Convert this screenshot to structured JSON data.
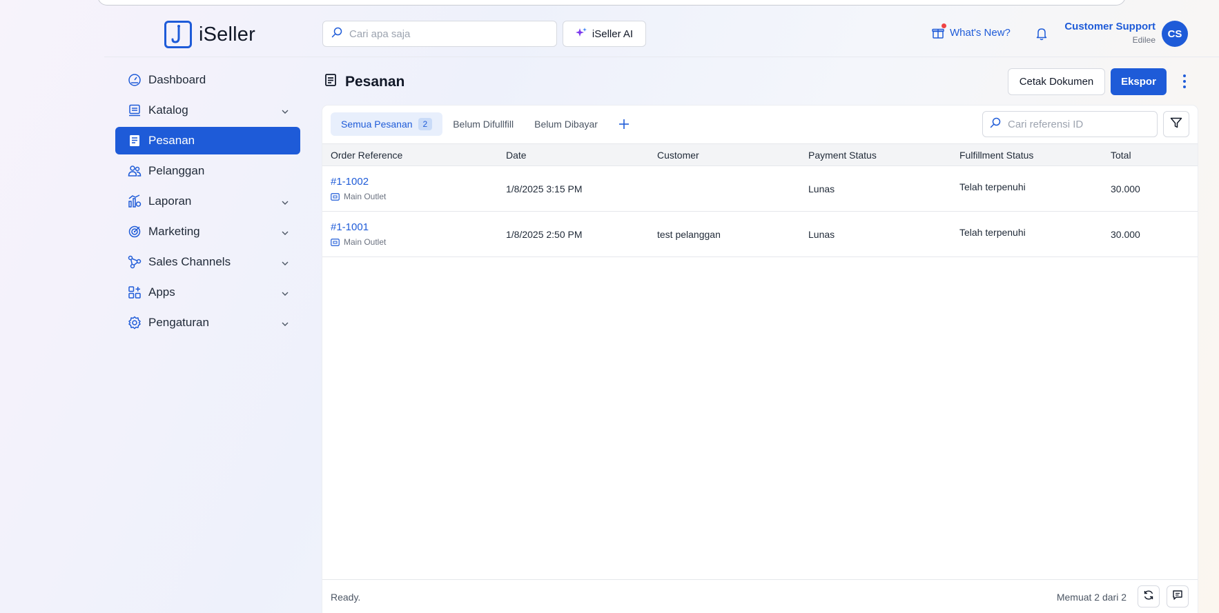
{
  "app": {
    "name": "iSeller"
  },
  "header": {
    "search_placeholder": "Cari apa saja",
    "ai_label": "iSeller AI",
    "whats_new_label": "What's New?",
    "user_name": "Customer Support",
    "user_org": "Edilee",
    "avatar_initials": "CS"
  },
  "sidebar": {
    "items": [
      {
        "label": "Dashboard",
        "icon": "dashboard-icon",
        "has_chevron": false
      },
      {
        "label": "Katalog",
        "icon": "catalog-icon",
        "has_chevron": true
      },
      {
        "label": "Pesanan",
        "icon": "orders-icon",
        "has_chevron": false,
        "active": true
      },
      {
        "label": "Pelanggan",
        "icon": "customers-icon",
        "has_chevron": false
      },
      {
        "label": "Laporan",
        "icon": "reports-icon",
        "has_chevron": true
      },
      {
        "label": "Marketing",
        "icon": "marketing-icon",
        "has_chevron": true
      },
      {
        "label": "Sales Channels",
        "icon": "sales-channels-icon",
        "has_chevron": true
      },
      {
        "label": "Apps",
        "icon": "apps-icon",
        "has_chevron": true
      },
      {
        "label": "Pengaturan",
        "icon": "settings-icon",
        "has_chevron": true
      }
    ]
  },
  "page": {
    "title": "Pesanan",
    "print_label": "Cetak Dokumen",
    "export_label": "Ekspor"
  },
  "tabs": [
    {
      "label": "Semua Pesanan",
      "count": "2",
      "active": true
    },
    {
      "label": "Belum Difullfill"
    },
    {
      "label": "Belum Dibayar"
    }
  ],
  "ref_search_placeholder": "Cari referensi ID",
  "table": {
    "columns": [
      "Order Reference",
      "Date",
      "Customer",
      "Payment Status",
      "Fulfillment Status",
      "Total"
    ],
    "rows": [
      {
        "ref": "#1-1002",
        "outlet": "Main Outlet",
        "date": "1/8/2025 3:15 PM",
        "customer": "",
        "payment": "Lunas",
        "fulfillment": "Telah terpenuhi",
        "total": "30.000"
      },
      {
        "ref": "#1-1001",
        "outlet": "Main Outlet",
        "date": "1/8/2025 2:50 PM",
        "customer": "test pelanggan",
        "payment": "Lunas",
        "fulfillment": "Telah terpenuhi",
        "total": "30.000"
      }
    ]
  },
  "footer": {
    "status": "Ready.",
    "count_text": "Memuat 2 dari 2"
  },
  "colors": {
    "accent": "#1e5bd8",
    "notification_dot": "#ef4444"
  }
}
